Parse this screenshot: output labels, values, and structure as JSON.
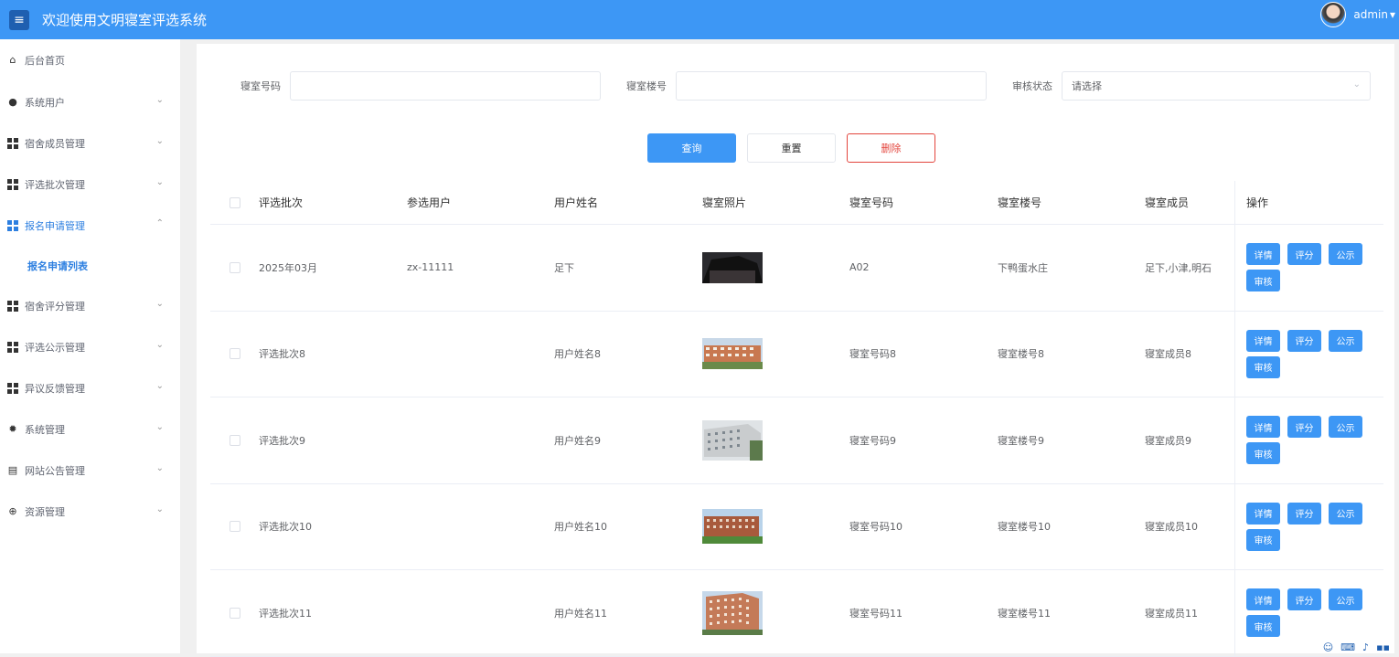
{
  "header": {
    "menu_icon": "≡",
    "title": "欢迎使用文明寝室评选系统",
    "user_name": "admin",
    "user_arrow": "▾"
  },
  "sidebar": {
    "items": [
      {
        "label": "后台首页",
        "icon": "home-icon",
        "has_chevron": false
      },
      {
        "label": "系统用户",
        "icon": "user-icon",
        "has_chevron": true
      },
      {
        "label": "宿舍成员管理",
        "icon": "grid-icon",
        "has_chevron": true
      },
      {
        "label": "评选批次管理",
        "icon": "grid-icon",
        "has_chevron": true
      },
      {
        "label": "报名申请管理",
        "icon": "grid-icon",
        "has_chevron": true,
        "active": true,
        "expanded": true
      },
      {
        "label": "宿舍评分管理",
        "icon": "grid-icon",
        "has_chevron": true
      },
      {
        "label": "评选公示管理",
        "icon": "grid-icon",
        "has_chevron": true
      },
      {
        "label": "异议反馈管理",
        "icon": "grid-icon",
        "has_chevron": true
      },
      {
        "label": "系统管理",
        "icon": "gear-icon",
        "has_chevron": true
      },
      {
        "label": "网站公告管理",
        "icon": "document-icon",
        "has_chevron": true
      },
      {
        "label": "资源管理",
        "icon": "plus-circle-icon",
        "has_chevron": true
      }
    ],
    "sub_item": "报名申请列表"
  },
  "search": {
    "dorm_no_label": "寝室号码",
    "dorm_no_value": "",
    "building_label": "寝室楼号",
    "building_value": "",
    "status_label": "审核状态",
    "status_value": "请选择"
  },
  "buttons": {
    "query": "查询",
    "reset": "重置",
    "delete": "删除"
  },
  "table": {
    "headers": [
      "评选批次",
      "参选用户",
      "用户姓名",
      "寝室照片",
      "寝室号码",
      "寝室楼号",
      "寝室成员",
      "操作"
    ],
    "op_labels": {
      "detail": "详情",
      "score": "评分",
      "publish": "公示",
      "review": "审核"
    },
    "rows": [
      {
        "batch": "2025年03月",
        "user": "zx-11111",
        "name": "足下",
        "dorm_no": "A02",
        "building": "下鸭蛋水庄",
        "members": "足下,小津,明石"
      },
      {
        "batch": "评选批次8",
        "user": "",
        "name": "用户姓名8",
        "dorm_no": "寝室号码8",
        "building": "寝室楼号8",
        "members": "寝室成员8"
      },
      {
        "batch": "评选批次9",
        "user": "",
        "name": "用户姓名9",
        "dorm_no": "寝室号码9",
        "building": "寝室楼号9",
        "members": "寝室成员9"
      },
      {
        "batch": "评选批次10",
        "user": "",
        "name": "用户姓名10",
        "dorm_no": "寝室号码10",
        "building": "寝室楼号10",
        "members": "寝室成员10"
      },
      {
        "batch": "评选批次11",
        "user": "",
        "name": "用户姓名11",
        "dorm_no": "寝室号码11",
        "building": "寝室楼号11",
        "members": "寝室成员11"
      }
    ]
  },
  "colors": {
    "primary": "#3d97f5",
    "danger": "#e3453d",
    "active_text": "#2d7fe0"
  }
}
